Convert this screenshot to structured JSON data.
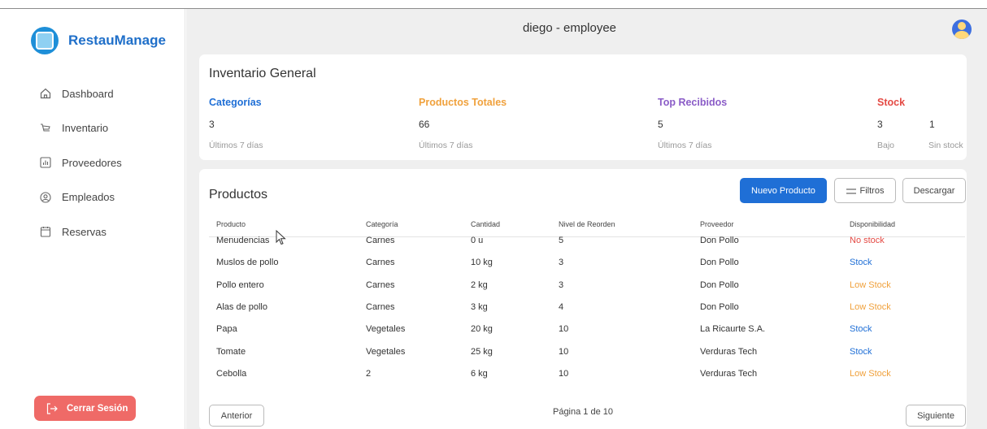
{
  "brand": {
    "name": "RestauManage"
  },
  "sidebar": {
    "items": [
      {
        "label": "Dashboard",
        "icon": "home-icon"
      },
      {
        "label": "Inventario",
        "icon": "cart-icon"
      },
      {
        "label": "Proveedores",
        "icon": "chart-icon"
      },
      {
        "label": "Empleados",
        "icon": "user-circle-icon"
      },
      {
        "label": "Reservas",
        "icon": "calendar-icon"
      }
    ],
    "logout_label": "Cerrar Sesión"
  },
  "header": {
    "title": "diego - employee"
  },
  "inventory": {
    "title": "Inventario General",
    "categorias": {
      "label": "Categorías",
      "value": "3",
      "sub": "Últimos 7 días",
      "color": "#1f6fd6"
    },
    "productos": {
      "label": "Productos Totales",
      "value": "66",
      "sub": "Últimos 7 días",
      "color": "#f0a13c"
    },
    "top": {
      "label": "Top Recibidos",
      "value": "5",
      "sub": "Últimos 7 días",
      "color": "#8a5cc7"
    },
    "stock": {
      "label": "Stock",
      "bajo_value": "3",
      "bajo_label": "Bajo",
      "sin_value": "1",
      "sin_label": "Sin stock",
      "color": "#e44a44"
    }
  },
  "products": {
    "title": "Productos",
    "new_label": "Nuevo Producto",
    "filter_label": "Filtros",
    "download_label": "Descargar",
    "columns": [
      "Producto",
      "Categoría",
      "Cantidad",
      "Nivel de Reorden",
      "Proveedor",
      "Disponibilidad"
    ],
    "rows": [
      [
        "Menudencias",
        "Carnes",
        "0 u",
        "5",
        "Don Pollo",
        "No stock"
      ],
      [
        "Muslos de pollo",
        "Carnes",
        "10 kg",
        "3",
        "Don Pollo",
        "Stock"
      ],
      [
        "Pollo entero",
        "Carnes",
        "2 kg",
        "3",
        "Don Pollo",
        "Low Stock"
      ],
      [
        "Alas de pollo",
        "Carnes",
        "3 kg",
        "4",
        "Don Pollo",
        "Low Stock"
      ],
      [
        "Papa",
        "Vegetales",
        "20 kg",
        "10",
        "La Ricaurte S.A.",
        "Stock"
      ],
      [
        "Tomate",
        "Vegetales",
        "25 kg",
        "10",
        "Verduras Tech",
        "Stock"
      ],
      [
        "Cebolla",
        "2",
        "6 kg",
        "10",
        "Verduras Tech",
        "Low Stock"
      ]
    ],
    "availability_colors": {
      "No stock": "#e44a44",
      "Stock": "#1f6fd6",
      "Low Stock": "#f0a13c"
    },
    "prev_label": "Anterior",
    "next_label": "Siguiente",
    "page_info": "Página 1 de 10"
  }
}
